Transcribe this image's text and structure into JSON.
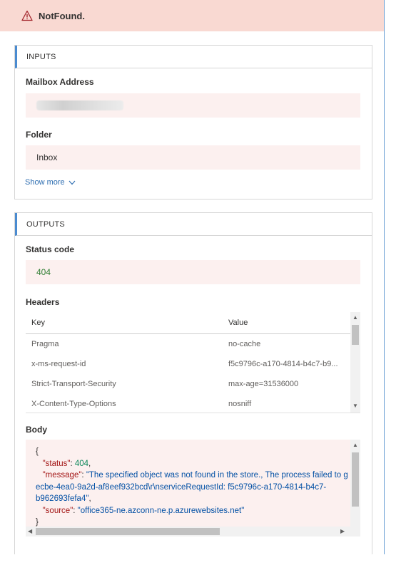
{
  "banner": {
    "message": "NotFound."
  },
  "inputs": {
    "header": "INPUTS",
    "mailbox_label": "Mailbox Address",
    "folder_label": "Folder",
    "folder_value": "Inbox",
    "show_more": "Show more"
  },
  "outputs": {
    "header": "OUTPUTS",
    "status_label": "Status code",
    "status_value": "404",
    "headers_label": "Headers",
    "headers_columns": {
      "key": "Key",
      "value": "Value"
    },
    "headers_rows": [
      {
        "key": "Pragma",
        "value": "no-cache"
      },
      {
        "key": "x-ms-request-id",
        "value": "f5c9796c-a170-4814-b4c7-b9..."
      },
      {
        "key": "Strict-Transport-Security",
        "value": "max-age=31536000"
      },
      {
        "key": "X-Content-Type-Options",
        "value": "nosniff"
      }
    ],
    "body_label": "Body",
    "body_lines": {
      "open": "{",
      "status_key": "\"status\"",
      "status_val": "404",
      "message_key": "\"message\"",
      "message_val_1": "\"The specified object was not found in the store., The process failed to g",
      "message_val_2": "ecbe-4ea0-9a2d-af8eef932bcd\\r\\nserviceRequestId: f5c9796c-a170-4814-b4c7-",
      "message_val_3": "b962693fefa4\"",
      "source_key": "\"source\"",
      "source_val": "\"office365-ne.azconn-ne.p.azurewebsites.net\"",
      "close": "}"
    }
  },
  "colors": {
    "error_banner": "#f9d9d2",
    "field_bg": "#fcf0ef",
    "accent": "#4a8bd0",
    "link": "#2b6cb0"
  },
  "icons": {
    "banner_icon": "warning-triangle-icon",
    "show_more_icon": "chevron-down-icon"
  }
}
